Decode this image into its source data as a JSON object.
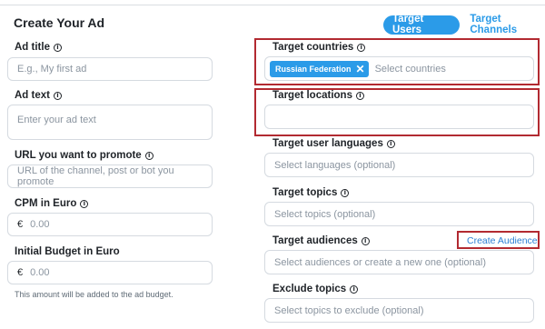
{
  "form": {
    "title": "Create Your Ad",
    "tabs": [
      {
        "label": "Target Users",
        "active": true
      },
      {
        "label": "Target Channels",
        "active": false
      }
    ],
    "left": {
      "ad_title": {
        "label": "Ad title",
        "placeholder": "E.g., My first ad"
      },
      "ad_text": {
        "label": "Ad text",
        "placeholder": "Enter your ad text"
      },
      "url": {
        "label": "URL you want to promote",
        "placeholder": "URL of the channel, post or bot you promote"
      },
      "cpm": {
        "label": "CPM in Euro",
        "currency": "€",
        "placeholder": "0.00"
      },
      "budget": {
        "label": "Initial Budget in Euro",
        "currency": "€",
        "placeholder": "0.00",
        "hint": "This amount will be added to the ad budget."
      }
    },
    "right": {
      "countries": {
        "label": "Target countries",
        "chip": "Russian Federation",
        "placeholder": "Select countries"
      },
      "locations": {
        "label": "Target locations",
        "placeholder": ""
      },
      "languages": {
        "label": "Target user languages",
        "placeholder": "Select languages (optional)"
      },
      "topics": {
        "label": "Target topics",
        "placeholder": "Select topics (optional)"
      },
      "audiences": {
        "label": "Target audiences",
        "link": "Create Audience",
        "placeholder": "Select audiences or create a new one (optional)"
      },
      "exclude": {
        "label": "Exclude topics",
        "placeholder": "Select topics to exclude (optional)"
      }
    }
  },
  "colors": {
    "accent": "#2b9be8",
    "highlight": "#b22a31"
  }
}
